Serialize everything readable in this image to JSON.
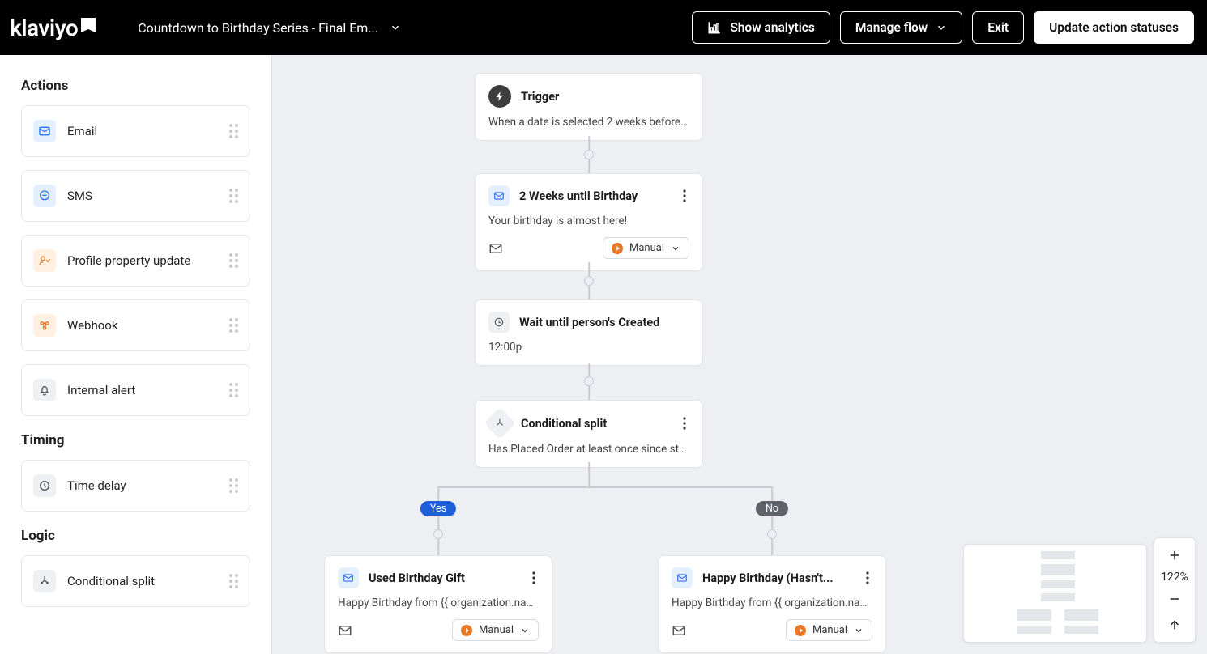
{
  "header": {
    "logo_text": "klaviyo",
    "flow_title": "Countdown to Birthday Series - Final Em...",
    "show_analytics": "Show analytics",
    "manage_flow": "Manage flow",
    "exit": "Exit",
    "update_statuses": "Update action statuses"
  },
  "sidebar": {
    "sections": {
      "actions": "Actions",
      "timing": "Timing",
      "logic": "Logic"
    },
    "actions": {
      "email": "Email",
      "sms": "SMS",
      "profile_update": "Profile property update",
      "webhook": "Webhook",
      "internal_alert": "Internal alert"
    },
    "timing": {
      "time_delay": "Time delay"
    },
    "logic": {
      "conditional_split": "Conditional split"
    }
  },
  "nodes": {
    "trigger": {
      "title": "Trigger",
      "desc": "When a date is selected 2 weeks before pe..."
    },
    "email1": {
      "title": "2 Weeks until Birthday",
      "desc": "Your birthday is almost here!",
      "status": "Manual"
    },
    "wait": {
      "title": "Wait until person's Created",
      "desc": "12:00p"
    },
    "split": {
      "title": "Conditional split",
      "desc": "Has Placed Order at least once since starti..."
    },
    "yes_email": {
      "title": "Used Birthday Gift",
      "desc": "Happy Birthday from {{ organization.name ...",
      "status": "Manual"
    },
    "no_email": {
      "title": "Happy Birthday (Hasn't...",
      "desc": "Happy Birthday from {{ organization.name ...",
      "status": "Manual"
    },
    "yes_label": "Yes",
    "no_label": "No"
  },
  "zoom": {
    "level": "122%"
  }
}
